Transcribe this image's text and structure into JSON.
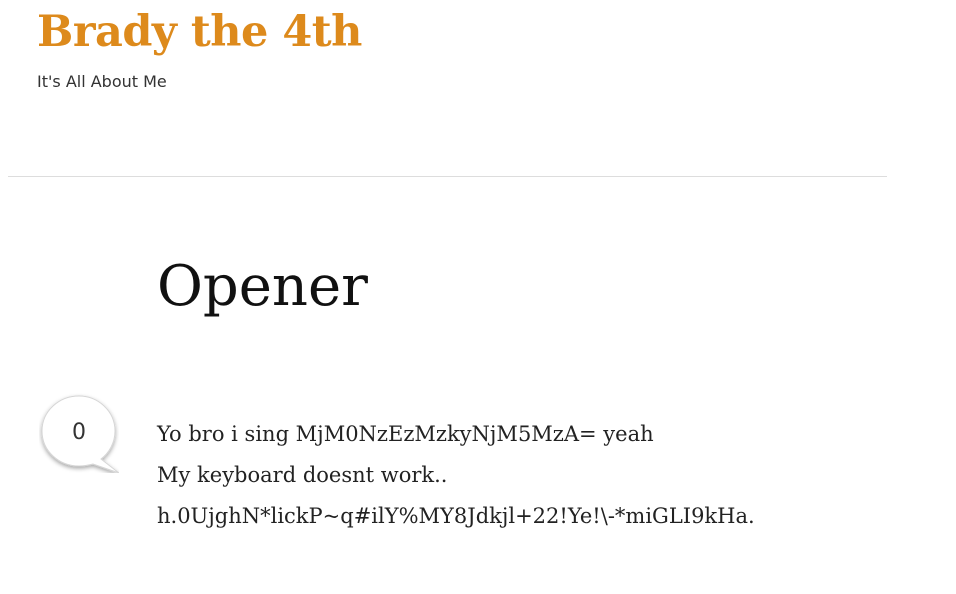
{
  "site": {
    "title": "Brady the 4th",
    "tagline": "It's All About Me",
    "accent_color": "#dd8a1c"
  },
  "post": {
    "title": "Opener",
    "comment_count": "0",
    "comment_icon": "speech-bubble-icon",
    "body_lines": [
      "Yo bro i sing MjM0NzEzMzkyNjM5MzA= yeah",
      "My keyboard doesnt work..",
      "h.0UjghN*lickP~q#ilY%MY8Jdkjl+22!Ye!\\-*miGLI9kHa."
    ]
  }
}
